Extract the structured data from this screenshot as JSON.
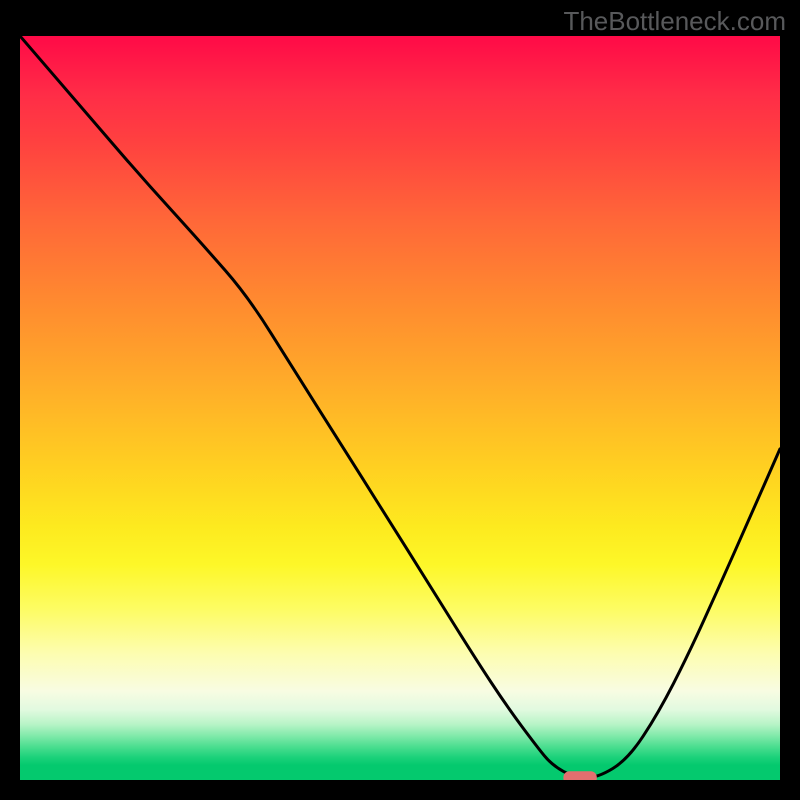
{
  "watermark": "TheBottleneck.com",
  "chart_data": {
    "type": "line",
    "title": "",
    "xlabel": "",
    "ylabel": "",
    "xlim": [
      0,
      1
    ],
    "ylim": [
      0,
      1
    ],
    "background_gradient": {
      "top_color": "#ff0a47",
      "bottom_color": "#04c96e",
      "semantics": "top = high bottleneck (bad), bottom = low bottleneck (good)"
    },
    "series": [
      {
        "name": "bottleneck-curve",
        "x": [
          0.0,
          0.08,
          0.16,
          0.24,
          0.3,
          0.36,
          0.42,
          0.48,
          0.54,
          0.6,
          0.64,
          0.68,
          0.7,
          0.73,
          0.76,
          0.8,
          0.84,
          0.88,
          0.92,
          0.96,
          1.0
        ],
        "y": [
          1.0,
          0.905,
          0.81,
          0.72,
          0.65,
          0.552,
          0.455,
          0.358,
          0.26,
          0.162,
          0.1,
          0.045,
          0.02,
          0.003,
          0.003,
          0.028,
          0.09,
          0.17,
          0.26,
          0.352,
          0.445
        ]
      }
    ],
    "marker": {
      "name": "optimal-point",
      "x": 0.737,
      "y": 0.003,
      "width_frac": 0.044,
      "color": "#e36f6f"
    }
  }
}
